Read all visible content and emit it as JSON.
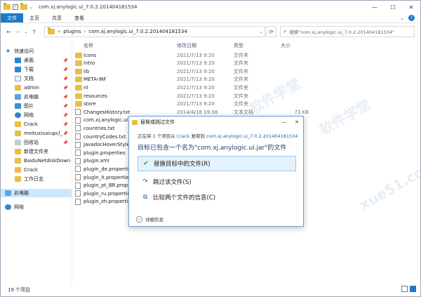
{
  "window": {
    "title": "com.xj.anylogic.ui_7.0.2.201404181534",
    "minimize": "—",
    "maximize": "☐",
    "close": "✕"
  },
  "ribbon": {
    "tabs": [
      "文件",
      "主页",
      "共享",
      "查看"
    ],
    "expand": "⌄",
    "help": "?"
  },
  "nav": {
    "back": "←",
    "forward": "→",
    "recent": "⌄",
    "up": "↑"
  },
  "address": {
    "overflow": "«",
    "segments": [
      "plugins",
      "com.xj.anylogic.ui_7.0.2.201404181534"
    ],
    "dropdown": "⌄",
    "refresh": "⟳"
  },
  "search": {
    "placeholder": "搜索\"com.xj.anylogic.ui_7.0.2.201404181534\""
  },
  "sidebar": {
    "items": [
      {
        "label": "快速访问",
        "icon": "star-icon",
        "pinned": false
      },
      {
        "label": "桌面",
        "icon": "desktop-icon",
        "pinned": true
      },
      {
        "label": "下载",
        "icon": "download-icon",
        "pinned": true
      },
      {
        "label": "文档",
        "icon": "document-icon",
        "pinned": true
      },
      {
        "label": "admin",
        "icon": "folder-icon",
        "pinned": true
      },
      {
        "label": "此电脑",
        "icon": "computer-icon",
        "pinned": true
      },
      {
        "label": "图片",
        "icon": "pictures-icon",
        "pinned": true
      },
      {
        "label": "网络",
        "icon": "network-icon",
        "pinned": true
      },
      {
        "label": "Crack",
        "icon": "folder-icon",
        "pinned": true
      },
      {
        "label": "meituxiuxiupcl_",
        "icon": "folder-icon",
        "pinned": true
      },
      {
        "label": "回收站",
        "icon": "recycle-bin-icon",
        "pinned": true
      },
      {
        "label": "新建文件夹",
        "icon": "folder-icon",
        "pinned": false
      },
      {
        "label": "BaiduNetdiskDown",
        "icon": "folder-icon",
        "pinned": false
      },
      {
        "label": "Crack",
        "icon": "folder-icon",
        "pinned": false
      },
      {
        "label": "工作日志",
        "icon": "folder-icon",
        "pinned": false
      },
      {
        "label": "此电脑",
        "icon": "computer-icon",
        "pinned": false
      },
      {
        "label": "网络",
        "icon": "network-icon",
        "pinned": false
      }
    ]
  },
  "columns": {
    "name": "名称",
    "date": "修改日期",
    "type": "类型",
    "size": "大小"
  },
  "files": [
    {
      "name": "icons",
      "date": "2021/7/13 9:20",
      "type": "文件夹",
      "size": "",
      "kind": "folder"
    },
    {
      "name": "intro",
      "date": "2021/7/13 9:20",
      "type": "文件夹",
      "size": "",
      "kind": "folder"
    },
    {
      "name": "lib",
      "date": "2021/7/13 9:20",
      "type": "文件夹",
      "size": "",
      "kind": "folder"
    },
    {
      "name": "META-INF",
      "date": "2021/7/13 9:20",
      "type": "文件夹",
      "size": "",
      "kind": "folder"
    },
    {
      "name": "nl",
      "date": "2021/7/13 9:20",
      "type": "文件夹",
      "size": "",
      "kind": "folder"
    },
    {
      "name": "resources",
      "date": "2021/7/13 9:20",
      "type": "文件夹",
      "size": "",
      "kind": "folder"
    },
    {
      "name": "store",
      "date": "2021/7/13 9:20",
      "type": "文件夹",
      "size": "",
      "kind": "folder"
    },
    {
      "name": "ChangesHistory.txt",
      "date": "2014/4/18 19:38",
      "type": "文本文档",
      "size": "73 KB",
      "kind": "file"
    },
    {
      "name": "com.xj.anylogic.ui.ja",
      "date": "",
      "type": "",
      "size": "",
      "kind": "file"
    },
    {
      "name": "countries.txt",
      "date": "",
      "type": "",
      "size": "",
      "kind": "file"
    },
    {
      "name": "countryCodes.txt",
      "date": "",
      "type": "",
      "size": "",
      "kind": "file"
    },
    {
      "name": "JavadocHoverStyleS",
      "date": "",
      "type": "",
      "size": "",
      "kind": "file"
    },
    {
      "name": "plugin.properties",
      "date": "",
      "type": "",
      "size": "",
      "kind": "file"
    },
    {
      "name": "plugin.xml",
      "date": "",
      "type": "",
      "size": "",
      "kind": "file"
    },
    {
      "name": "plugin_de.propertie",
      "date": "",
      "type": "",
      "size": "",
      "kind": "file"
    },
    {
      "name": "plugin_it.properties",
      "date": "",
      "type": "",
      "size": "",
      "kind": "file"
    },
    {
      "name": "plugin_pt_BR.proper",
      "date": "",
      "type": "",
      "size": "",
      "kind": "file"
    },
    {
      "name": "plugin_ru.propertie",
      "date": "",
      "type": "",
      "size": "",
      "kind": "file"
    },
    {
      "name": "plugin_zh.propertie",
      "date": "",
      "type": "",
      "size": "",
      "kind": "file"
    }
  ],
  "status": {
    "count": "19 个项目"
  },
  "dialog": {
    "title": "替换或跳过文件",
    "info_prefix": "正在将 1 个项目从 ",
    "info_src": "Crack",
    "info_mid": " 复制到 ",
    "info_dst": "com.xj.anylogic.ui_7.0.2.201404181534",
    "heading": "目标已包含一个名为\"com.xj.anylogic.ui.jar\"的文件",
    "opt_replace": "替换目标中的文件(R)",
    "opt_skip": "跳过该文件(S)",
    "opt_compare": "比较两个文件的信息(C)",
    "details": "详细信息",
    "close": "✕",
    "min": "—"
  },
  "watermark": {
    "text": "软件学堂",
    "url": "xue51.com"
  },
  "colors": {
    "accent": "#1979ca",
    "selection": "#cce8ff",
    "folder": "#e8bf45"
  }
}
